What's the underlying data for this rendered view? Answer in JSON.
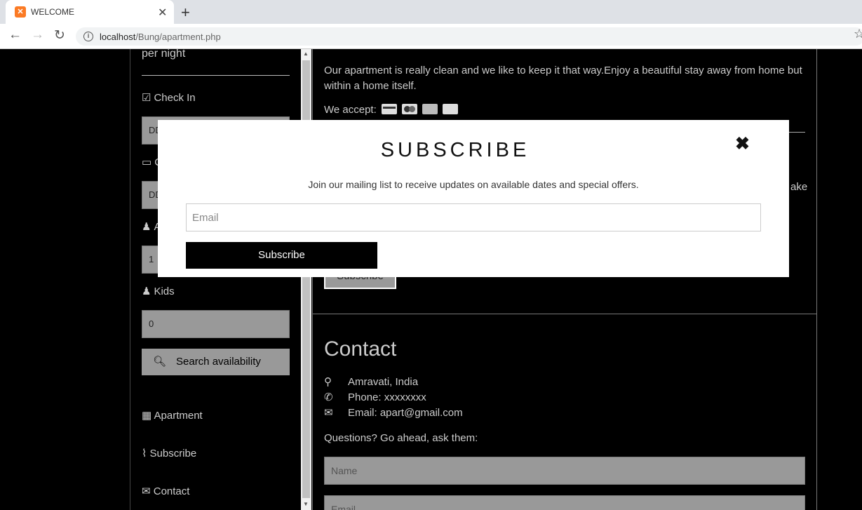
{
  "browser": {
    "tab_title": "WELCOME",
    "favicon": "xampp-icon",
    "url_host": "localhost",
    "url_path": "/Bung/apartment.php"
  },
  "sidebar": {
    "price_tail": "per night",
    "check_in_label": "Check In",
    "check_in_placeholder": "DD",
    "check_out_label": "C",
    "check_out_placeholder": "DD",
    "adults_label": "A",
    "adults_value": "1",
    "kids_label": "Kids",
    "kids_value": "0",
    "search_label": "Search availability",
    "links": {
      "apartment": "Apartment",
      "subscribe": "Subscribe",
      "contact": "Contact"
    }
  },
  "main": {
    "about_text": "Our apartment is really clean and we like to keep it that way.Enjoy a beautiful stay away from home but within a home itself.",
    "we_accept": "We accept:",
    "cut_text": "ake",
    "subscribe_btn_bg": "Subscribe",
    "contact_heading": "Contact",
    "contact": {
      "location": "Amravati, India",
      "phone": "Phone: xxxxxxxx",
      "email": "Email: apart@gmail.com"
    },
    "questions": "Questions? Go ahead, ask them:",
    "name_placeholder": "Name",
    "email_placeholder": "Email"
  },
  "modal": {
    "title": "SUBSCRIBE",
    "description": "Join our mailing list to receive updates on available dates and special offers.",
    "email_placeholder": "Email",
    "submit_label": "Subscribe"
  }
}
